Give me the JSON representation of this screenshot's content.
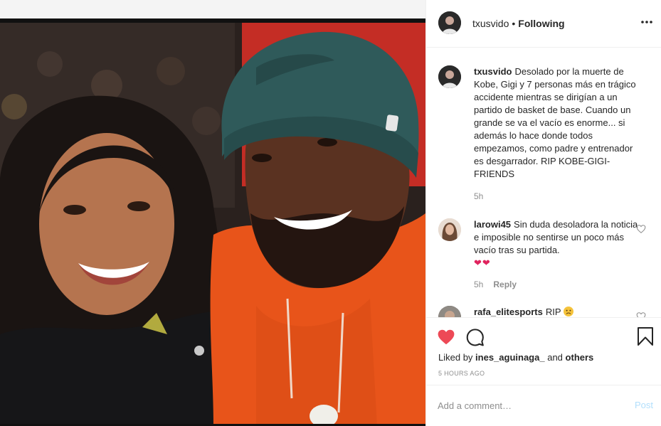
{
  "post": {
    "photo_alt": "Photo of Kobe and Gigi smiling at a basketball game"
  },
  "header": {
    "username": "txusvido",
    "separator": "•",
    "follow_state": "Following",
    "more_icon": "more-horizontal-icon"
  },
  "caption": {
    "author": "txusvido",
    "text": "Desolado por la muerte de Kobe, Gigi y 7 personas más en trágico accidente mientras se dirigían a un partido de basket de base. Cuando un grande se va el vacío es enorme... si además lo hace donde todos empezamos, como padre y entrenador es desgarrador. RIP KOBE-GIGI-FRIENDS",
    "time": "5h"
  },
  "comments": [
    {
      "author": "larowi45",
      "text": "Sin duda desoladora la noticia e imposible no sentirse un poco más vacío tras su partida.",
      "emoji": "❤❤",
      "time": "5h",
      "reply_label": "Reply"
    },
    {
      "author": "rafa_elitesports",
      "text": "RIP",
      "emoji_icon": "sad-face-emoji"
    }
  ],
  "actions": {
    "like_icon": "heart-filled-icon",
    "comment_icon": "comment-icon",
    "save_icon": "bookmark-icon",
    "liked_by_prefix": "Liked by",
    "liked_by_user": "ines_aguinaga_",
    "liked_by_and": "and",
    "liked_by_others": "others",
    "time_ago": "5 HOURS AGO"
  },
  "add_comment": {
    "placeholder": "Add a comment…",
    "post_label": "Post"
  },
  "colors": {
    "like_red": "#ed4956",
    "muted_text": "#8e8e8e",
    "post_disabled": "#b2dffc",
    "hoodie_orange": "#e8541a",
    "beanie_teal": "#2f5a5a"
  }
}
